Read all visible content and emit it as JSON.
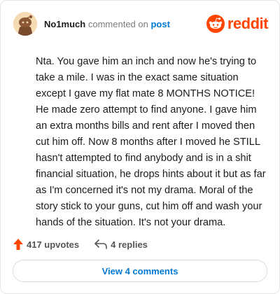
{
  "header": {
    "username": "No1much",
    "action_text": "commented on",
    "post_link": "post",
    "brand": "reddit",
    "avatar_icon": "avatar-snoo-icon",
    "brand_icon": "reddit-logo-icon"
  },
  "comment": {
    "text": "Nta. You gave him an inch and now he's trying to take a mile. I was in the exact same situation except I gave my flat mate 8 MONTHS NOTICE! He made zero attempt to find anyone. I gave him an extra months bills and rent after I moved then cut him off. Now 8 months after I moved he STILL hasn't attempted to find anybody and is in a shit financial situation, he drops hints about it but as far as I'm concerned it's not my drama. Moral of the story stick to your guns, cut him off and wash your hands of the situation. It's not your drama."
  },
  "actions": {
    "upvotes_label": "417 upvotes",
    "replies_label": "4 replies",
    "upvote_icon": "upvote-arrow-icon",
    "reply_icon": "reply-arrow-icon"
  },
  "view_comments_label": "View 4 comments",
  "colors": {
    "brand": "#ff4500",
    "link": "#0079d3",
    "text": "#1c1c1c",
    "muted": "#7c7c7c"
  }
}
